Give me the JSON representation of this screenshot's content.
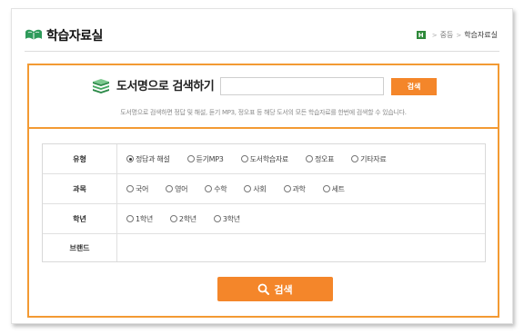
{
  "header": {
    "title": "학습자료실",
    "breadcrumb": {
      "home": "H",
      "level1": "중등",
      "current": "학습자료실"
    }
  },
  "search": {
    "title": "도서명으로 검색하기",
    "input_value": "",
    "button": "검색",
    "description": "도서명으로 검색하면 정답 및 해설, 듣기 MP3, 정오표 등 해당 도서의 모든 학습자료를 한번에 검색할 수 있습니다."
  },
  "filters": {
    "type": {
      "label": "유형",
      "options": [
        "정답과 해설",
        "듣기MP3",
        "도서학습자료",
        "정오표",
        "기타자료"
      ],
      "selected_index": 0
    },
    "subject": {
      "label": "과목",
      "options": [
        "국어",
        "영어",
        "수학",
        "사회",
        "과학",
        "세트"
      ]
    },
    "grade": {
      "label": "학년",
      "options": [
        "1학년",
        "2학년",
        "3학년"
      ]
    },
    "brand": {
      "label": "브랜드"
    }
  },
  "main_search": {
    "label": "검색"
  },
  "colors": {
    "accent": "#f4862a",
    "border": "#f39a33",
    "home": "#2f8a3a"
  }
}
